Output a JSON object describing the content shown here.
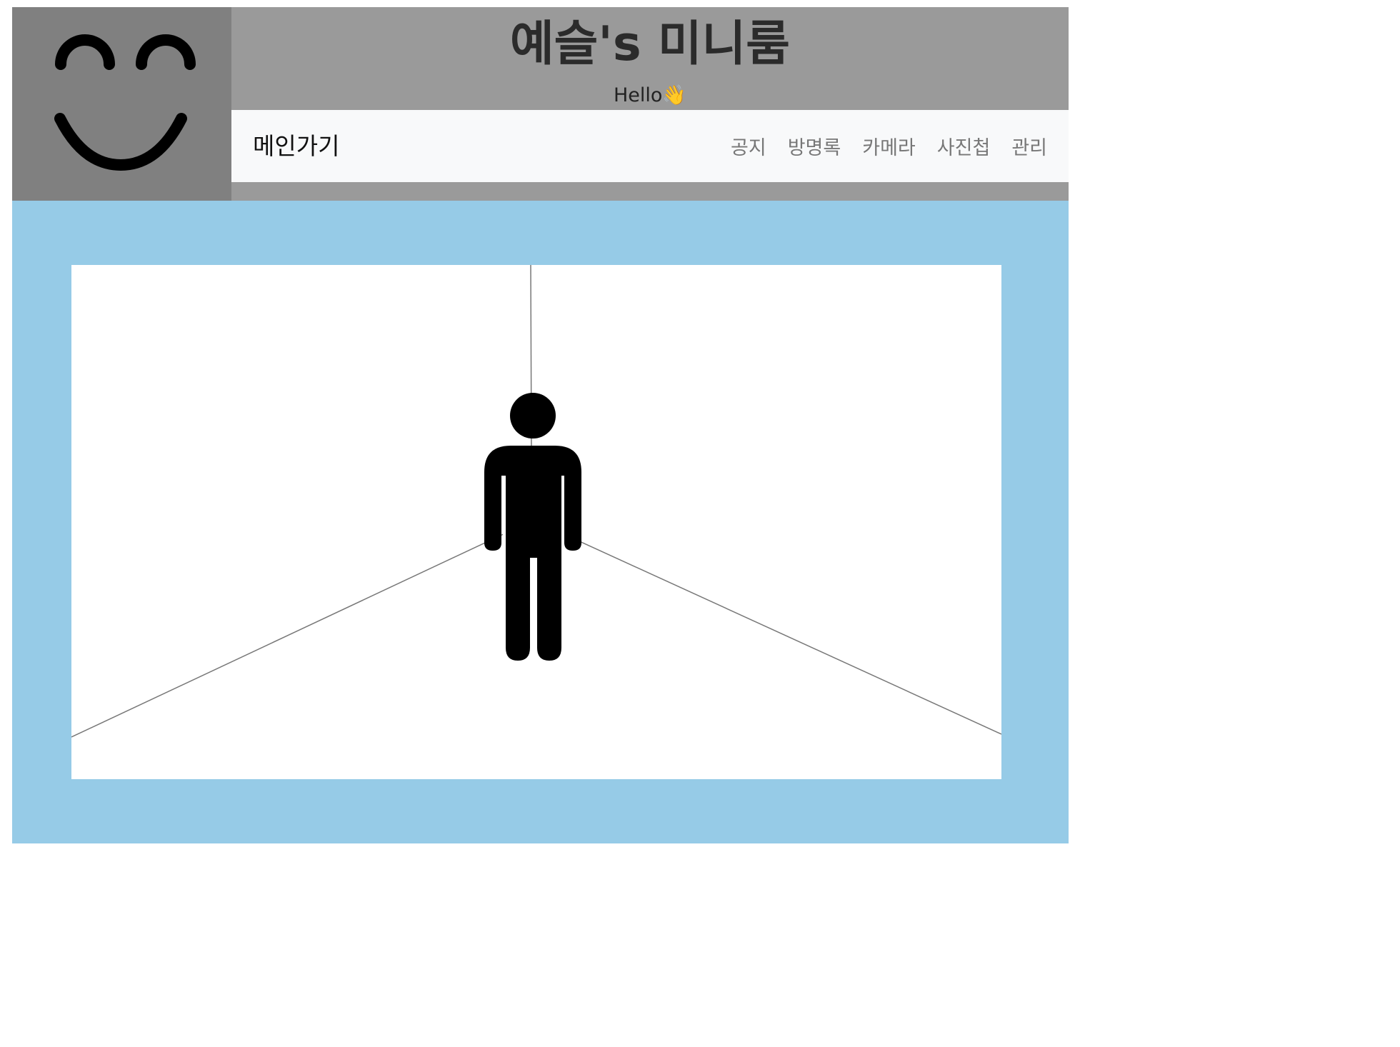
{
  "header": {
    "logo_icon": "smiley-face-icon",
    "title": "예슬's 미니룸",
    "subtitle": "Hello👋"
  },
  "navbar": {
    "brand": "메인가기",
    "links": [
      "공지",
      "방명록",
      "카메라",
      "사진첩",
      "관리"
    ]
  },
  "room": {
    "character_icon": "person-icon"
  },
  "colors": {
    "header_bg": "#9a9a9a",
    "logo_bg": "#808080",
    "navbar_bg": "#f8f9fa",
    "stage_bg": "#96cbe7",
    "room_bg": "#ffffff"
  }
}
